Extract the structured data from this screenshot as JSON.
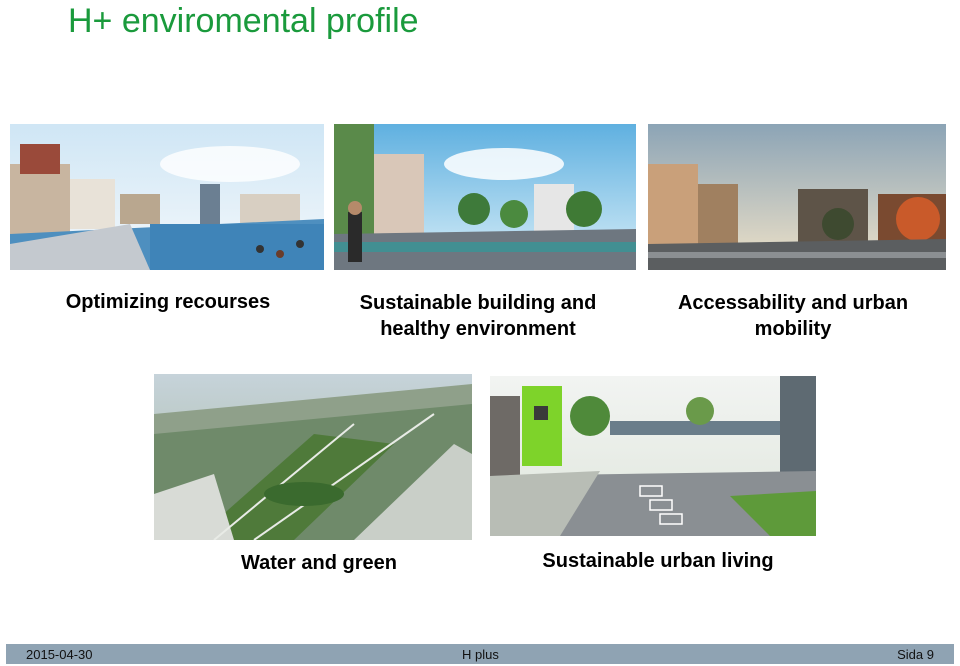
{
  "slide": {
    "title": "H+ enviromental profile"
  },
  "panels": [
    {
      "caption_line1": "Optimizing recourses",
      "caption_line2": ""
    },
    {
      "caption_line1": "Sustainable building and",
      "caption_line2": "healthy environment"
    },
    {
      "caption_line1": "Accessability and urban",
      "caption_line2": "mobility"
    },
    {
      "caption_line1": "Water and green",
      "caption_line2": ""
    },
    {
      "caption_line1": "Sustainable urban living",
      "caption_line2": ""
    }
  ],
  "footer": {
    "date": "2015-04-30",
    "center": "H plus",
    "page": "Sida 9"
  },
  "colors": {
    "title": "#1a9a3c",
    "footer_bar": "#8fa3b3"
  }
}
